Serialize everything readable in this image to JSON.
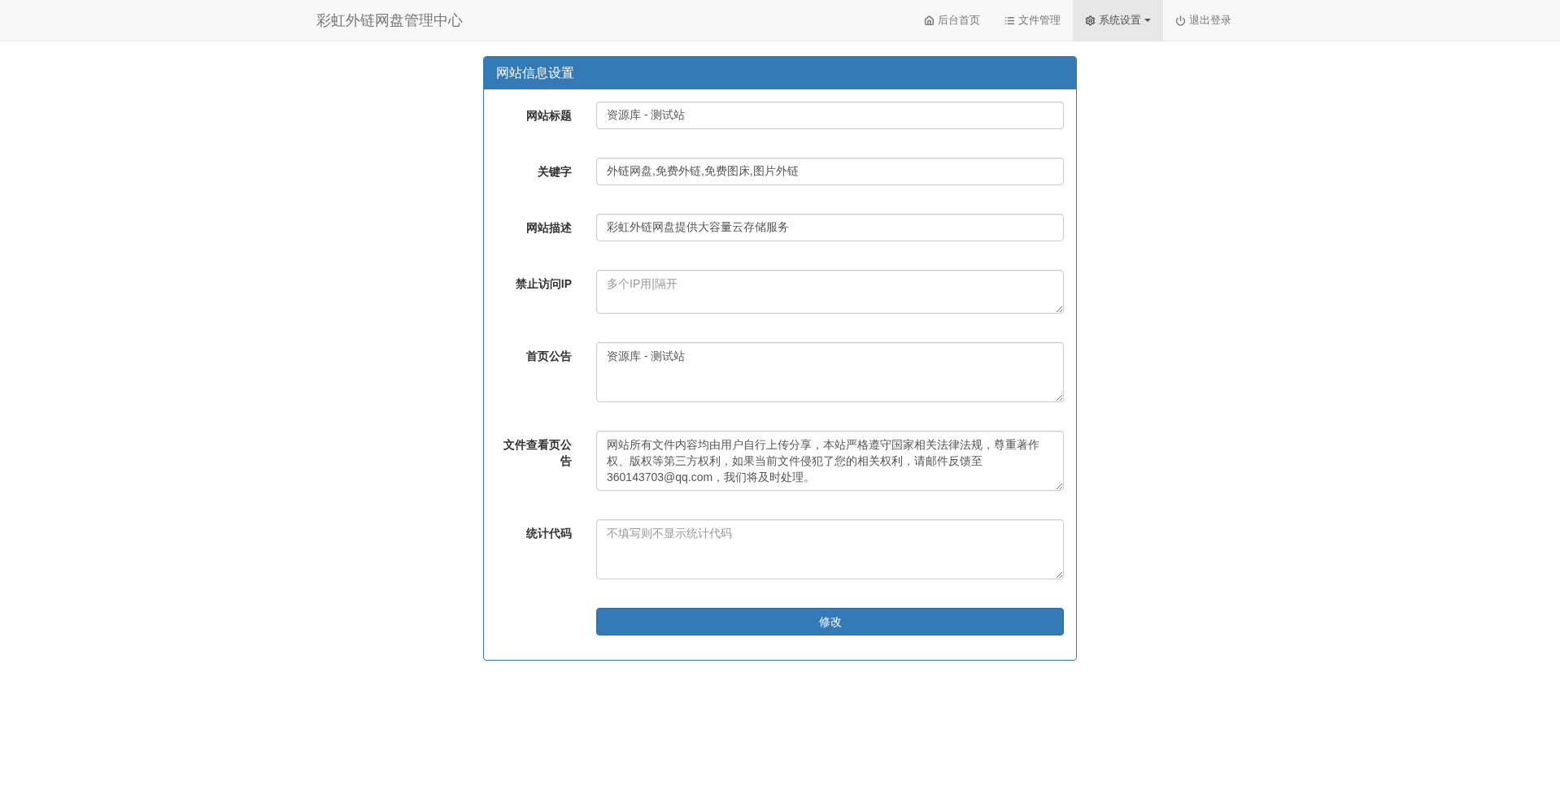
{
  "navbar": {
    "brand": "彩虹外链网盘管理中心",
    "items": [
      {
        "label": "后台首页",
        "selected": false,
        "dropdown": false
      },
      {
        "label": "文件管理",
        "selected": false,
        "dropdown": false
      },
      {
        "label": "系统设置",
        "selected": true,
        "dropdown": true
      },
      {
        "label": "退出登录",
        "selected": false,
        "dropdown": false
      }
    ]
  },
  "panel": {
    "title": "网站信息设置",
    "fields": [
      {
        "label": "网站标题",
        "kind": "input",
        "value": "资源库 - 测试站"
      },
      {
        "label": "关键字",
        "kind": "input",
        "value": "外链网盘,免费外链,免费图床,图片外链"
      },
      {
        "label": "网站描述",
        "kind": "input",
        "value": "彩虹外链网盘提供大容量云存储服务"
      },
      {
        "label": "禁止访问IP",
        "kind": "textarea",
        "placeholder": "多个IP用|隔开"
      },
      {
        "label": "首页公告",
        "kind": "textarea_large",
        "value": "资源库 - 测试站"
      },
      {
        "label": "文件查看页公告",
        "kind": "textarea_large",
        "value": "网站所有文件内容均由用户自行上传分享，本站严格遵守国家相关法律法规，尊重著作权、版权等第三方权利，如果当前文件侵犯了您的相关权利，请邮件反馈至360143703@qq.com，我们将及时处理。"
      },
      {
        "label": "统计代码",
        "kind": "textarea_large",
        "placeholder": "不填写则不显示统计代码"
      }
    ],
    "submit": "修改"
  }
}
